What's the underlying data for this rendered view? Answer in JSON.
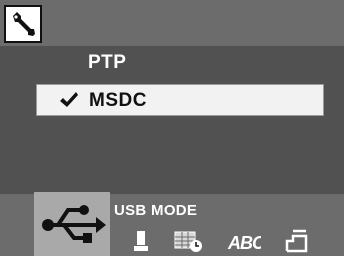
{
  "settings": {
    "section_icon": "wrench-icon",
    "options": [
      {
        "label": "PTP",
        "selected": false
      },
      {
        "label": "MSDC",
        "selected": true
      }
    ],
    "selected_marker": "checkmark-icon",
    "mode_label": "USB MODE"
  },
  "tabs": [
    {
      "icon": "usb-icon",
      "active": true
    },
    {
      "icon": "key-icon",
      "active": false
    },
    {
      "icon": "calendar-clock-icon",
      "active": false
    },
    {
      "icon": "abc-icon",
      "label": "ABC",
      "active": false
    },
    {
      "icon": "reset-icon",
      "active": false
    }
  ],
  "colors": {
    "background": "#515151",
    "bar": "#6c6c6c",
    "active_tab": "#a9a9a9",
    "selected_row": "#f2f2f2",
    "text": "#ffffff"
  }
}
